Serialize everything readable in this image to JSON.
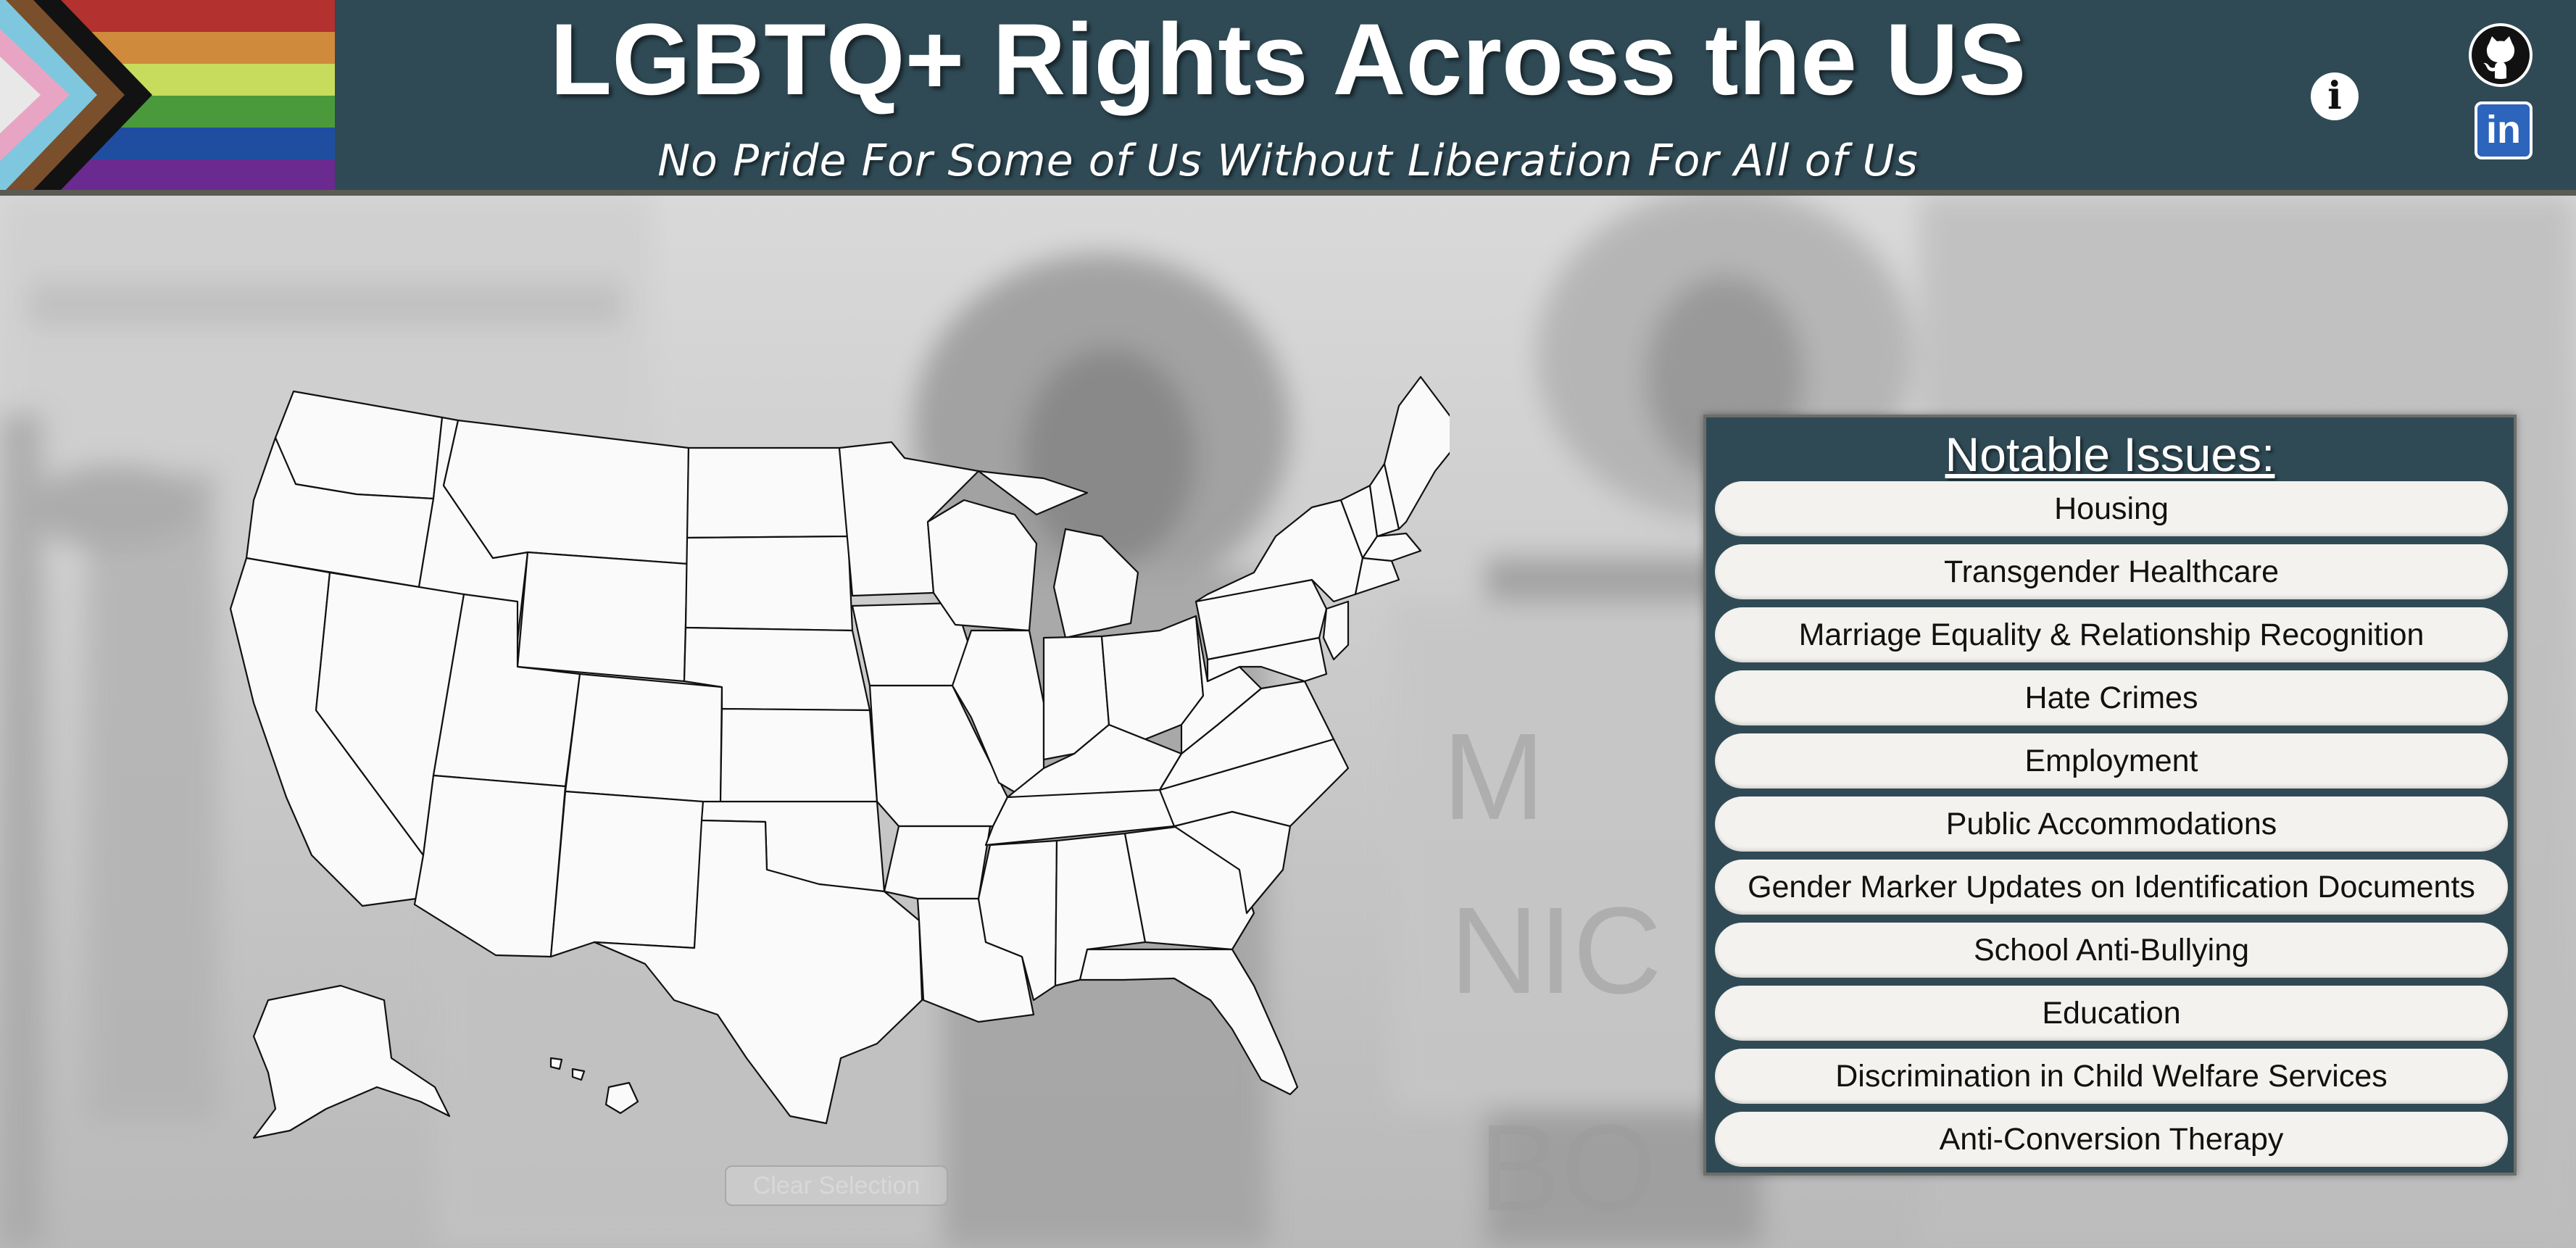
{
  "header": {
    "title": "LGBTQ+ Rights Across the US",
    "subtitle": "No Pride For Some of Us Without Liberation For All of Us"
  },
  "icons": {
    "info": "info-icon",
    "github": "github-icon",
    "linkedin": "linkedin-icon"
  },
  "info_label": "i",
  "linkedin_label": "in",
  "map": {
    "clear_label": "Clear Selection"
  },
  "panel": {
    "title": "Notable Issues:",
    "issues": [
      "Housing",
      "Transgender Healthcare",
      "Marriage Equality & Relationship Recognition",
      "Hate Crimes",
      "Employment",
      "Public Accommodations",
      "Gender Marker Updates on Identification Documents",
      "School Anti-Bullying",
      "Education",
      "Discrimination in Child Welfare Services",
      "Anti-Conversion Therapy"
    ]
  },
  "colors": {
    "header_bg": "#2f4a55",
    "panel_bg": "#2f4a55",
    "button_bg": "#f4f2ee",
    "linkedin_blue": "#2d64bc",
    "flag_stripes": [
      "#b3312f",
      "#d08a3b",
      "#c7dc5c",
      "#4a9a3c",
      "#1f4ea1",
      "#6a2a8f"
    ],
    "flag_chevrons": [
      "#121212",
      "#7a4f2b",
      "#7fc7de",
      "#e8a5c3",
      "#e8e8e8"
    ]
  }
}
